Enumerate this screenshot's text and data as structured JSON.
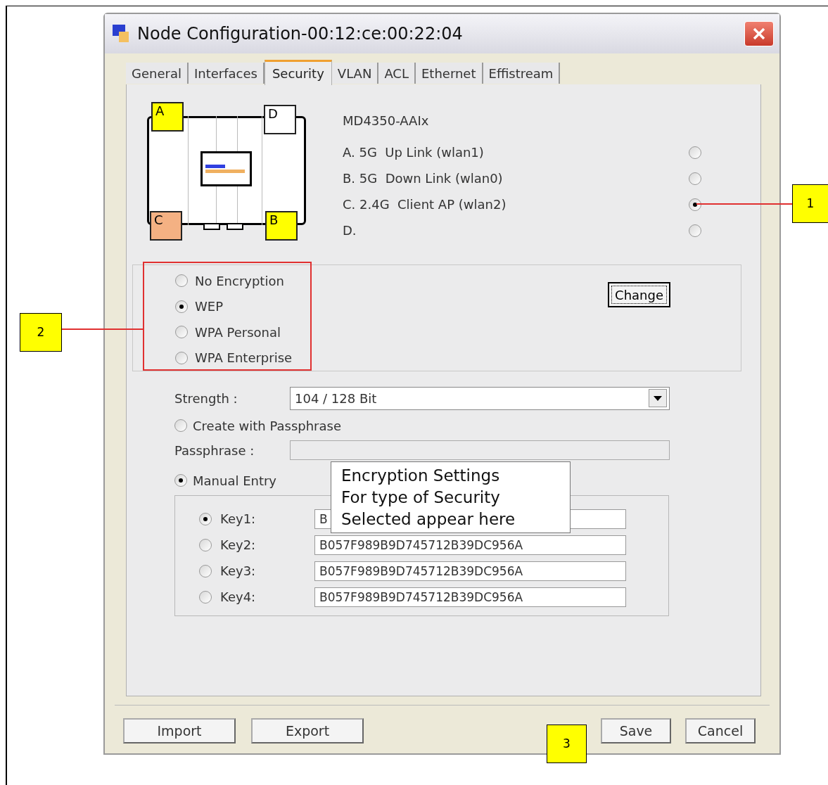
{
  "window": {
    "title": "Node Configuration-00:12:ce:00:22:04"
  },
  "tabs": [
    {
      "label": "General",
      "selected": false
    },
    {
      "label": "Interfaces",
      "selected": false
    },
    {
      "label": "Security",
      "selected": true
    },
    {
      "label": "VLAN",
      "selected": false
    },
    {
      "label": "ACL",
      "selected": false
    },
    {
      "label": "Ethernet",
      "selected": false
    },
    {
      "label": "Effistream",
      "selected": false
    }
  ],
  "device": {
    "ports": [
      {
        "label": "A",
        "color": "#ffff00"
      },
      {
        "label": "D",
        "color": "#ffffff"
      },
      {
        "label": "C",
        "color": "#f4b183"
      },
      {
        "label": "B",
        "color": "#ffff00"
      }
    ]
  },
  "model": "MD4350-AAIx",
  "interfaces": [
    {
      "label": "A. 5G  Up Link (wlan1)",
      "selected": false
    },
    {
      "label": "B. 5G  Down Link (wlan0)",
      "selected": false
    },
    {
      "label": "C. 2.4G  Client AP (wlan2)",
      "selected": true
    },
    {
      "label": "D.",
      "selected": false
    }
  ],
  "encryption": [
    {
      "label": "No Encryption",
      "selected": false
    },
    {
      "label": "WEP",
      "selected": true
    },
    {
      "label": "WPA Personal",
      "selected": false
    },
    {
      "label": "WPA Enterprise",
      "selected": false
    }
  ],
  "change_button": "Change",
  "strength": {
    "label": "Strength :",
    "value": "104 / 128 Bit"
  },
  "passphrase_option": {
    "label": "Create with Passphrase",
    "selected": false
  },
  "passphrase": {
    "label": "Passphrase :"
  },
  "manual_option": {
    "label": "Manual Entry",
    "selected": true
  },
  "keys": [
    {
      "label": "Key1:",
      "selected": true,
      "value": "B"
    },
    {
      "label": "Key2:",
      "selected": false,
      "value": "B057F989B9D745712B39DC956A"
    },
    {
      "label": "Key3:",
      "selected": false,
      "value": "B057F989B9D745712B39DC956A"
    },
    {
      "label": "Key4:",
      "selected": false,
      "value": "B057F989B9D745712B39DC956A"
    }
  ],
  "buttons_left": [
    "Import",
    "Export"
  ],
  "buttons_right": [
    "Save",
    "Cancel"
  ],
  "callouts": [
    "1",
    "2",
    "3"
  ],
  "note": [
    "Encryption Settings",
    "For type of Security",
    "Selected appear here"
  ]
}
